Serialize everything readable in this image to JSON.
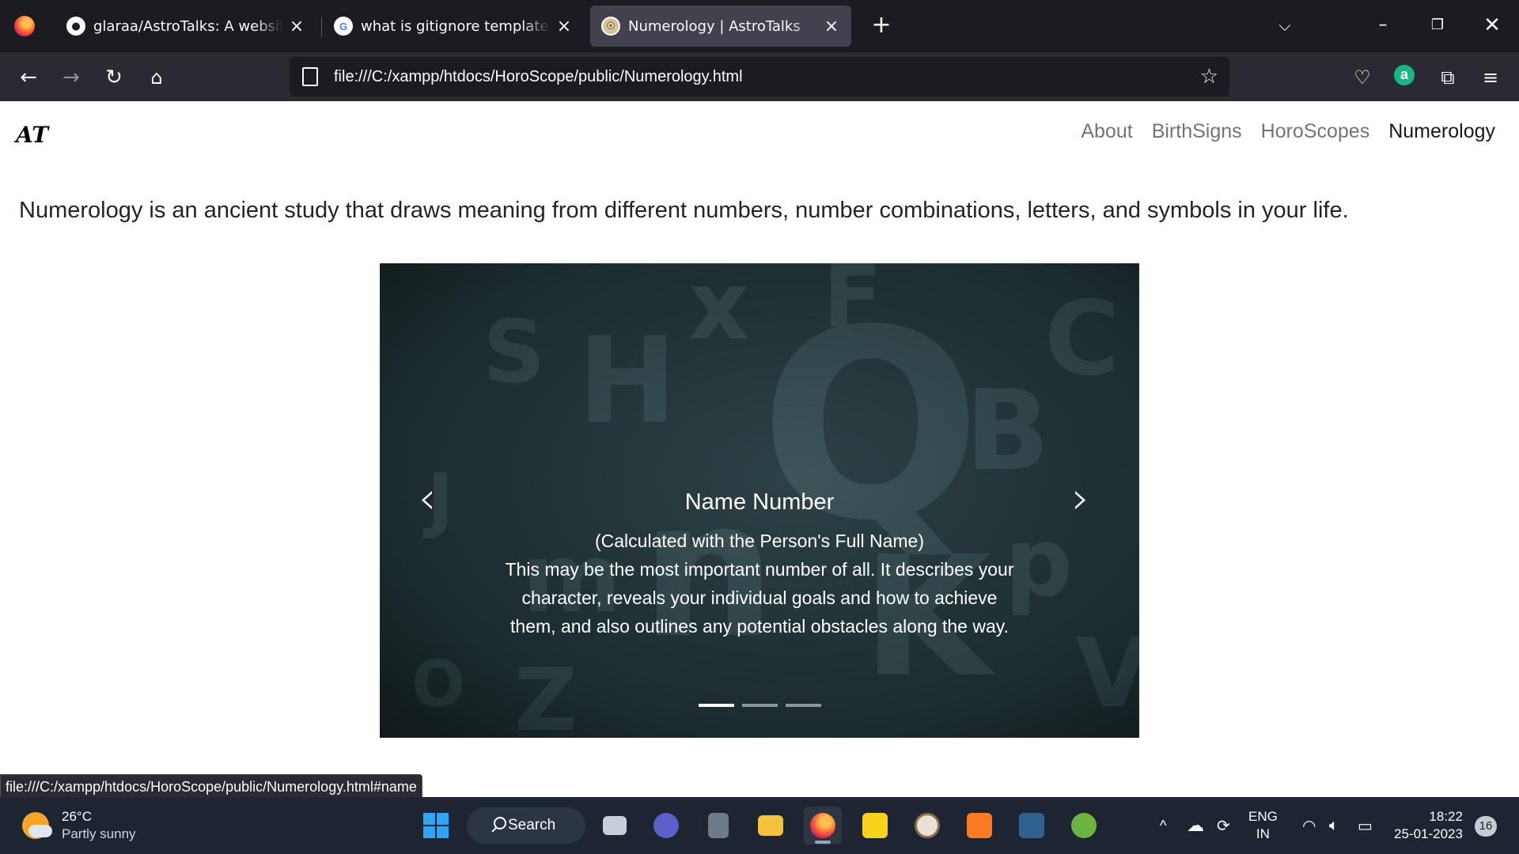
{
  "browser": {
    "tabs": [
      {
        "title": "glaraa/AstroTalks: A website wh",
        "icon": "github-icon"
      },
      {
        "title": "what is gitignore template - Go",
        "icon": "google-icon"
      },
      {
        "title": "Numerology | AstroTalks",
        "icon": "astrotalks-icon",
        "active": true
      }
    ],
    "url": "file:///C:/xampp/htdocs/HoroScope/public/Numerology.html",
    "status_url": "file:///C:/xampp/htdocs/HoroScope/public/Numerology.html#name",
    "account_initial": "a"
  },
  "site": {
    "brand": "AT",
    "nav": [
      "About",
      "BirthSigns",
      "HoroScopes",
      "Numerology"
    ],
    "active_nav": "Numerology",
    "intro": "Numerology is an ancient study that draws meaning from different numbers, number combinations, letters, and symbols in your life.",
    "carousel": {
      "title": "Name Number",
      "subtitle": "(Calculated with the Person's Full Name)",
      "text": "This may be the most important number of all. It describes your character, reveals your individual goals and how to achieve them, and also outlines any potential obstacles along the way.",
      "slide_count": 3,
      "active_slide": 0,
      "prev_icon": "chevron-left-icon",
      "next_icon": "chevron-right-icon"
    }
  },
  "taskbar": {
    "weather": {
      "temp": "26°C",
      "condition": "Partly sunny"
    },
    "search_label": "Search",
    "lang": {
      "line1": "ENG",
      "line2": "IN"
    },
    "time": "18:22",
    "date": "25-01-2023",
    "notifications": "16"
  }
}
